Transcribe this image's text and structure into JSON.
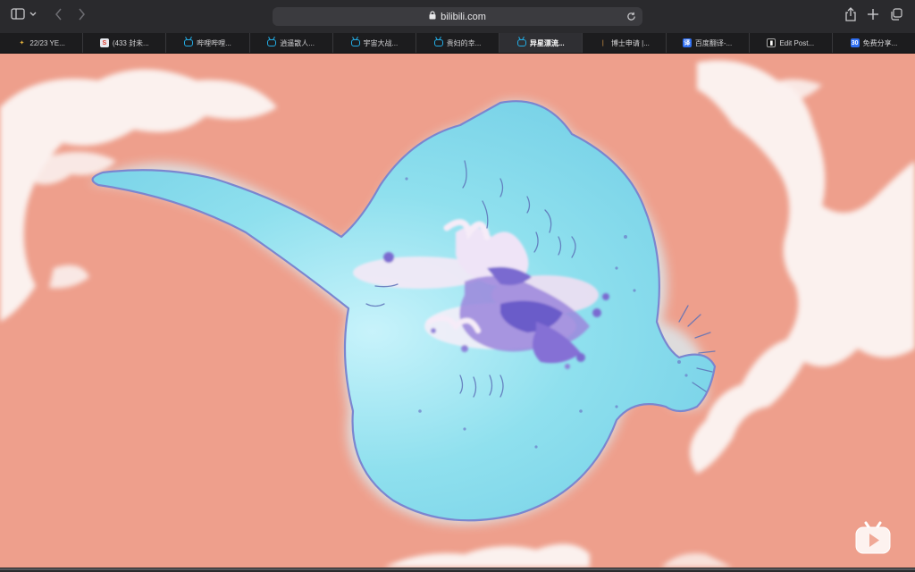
{
  "browser": {
    "url": "bilibili.com",
    "icons": {
      "sidebar": "sidebar-icon",
      "back": "chevron-left-icon",
      "forward": "chevron-right-icon",
      "lock": "lock-icon",
      "reload": "reload-icon",
      "share": "share-icon",
      "new_tab": "plus-icon",
      "tab_overview": "tab-overview-icon"
    },
    "tabs": [
      {
        "label": "22/23 YE...",
        "favicon": "star",
        "active": false
      },
      {
        "label": "(433 封未...",
        "favicon": "red",
        "favicon_text": "S",
        "active": false
      },
      {
        "label": "哔哩哔哩...",
        "favicon": "bili",
        "active": false
      },
      {
        "label": "逍遥散人...",
        "favicon": "bili",
        "active": false
      },
      {
        "label": "宇宙大战...",
        "favicon": "bili",
        "active": false
      },
      {
        "label": "贵妇的幸...",
        "favicon": "bili",
        "active": false
      },
      {
        "label": "异星漂流...",
        "favicon": "bili",
        "active": true
      },
      {
        "label": "博士申请 |...",
        "favicon": "person",
        "active": false
      },
      {
        "label": "百度翻译-...",
        "favicon": "blue",
        "favicon_text": "译",
        "active": false
      },
      {
        "label": "Edit Post...",
        "favicon": "dark",
        "favicon_text": "▮",
        "active": false
      },
      {
        "label": "免费分享...",
        "favicon": "blue",
        "favicon_text": "30",
        "active": false
      }
    ]
  },
  "video": {
    "background_color": "#ee9f8c",
    "creature_color": "#8fe0ee",
    "cloud_color": "#fbf1ee",
    "watermark_icon": "bilibili-tv-logo-icon"
  }
}
